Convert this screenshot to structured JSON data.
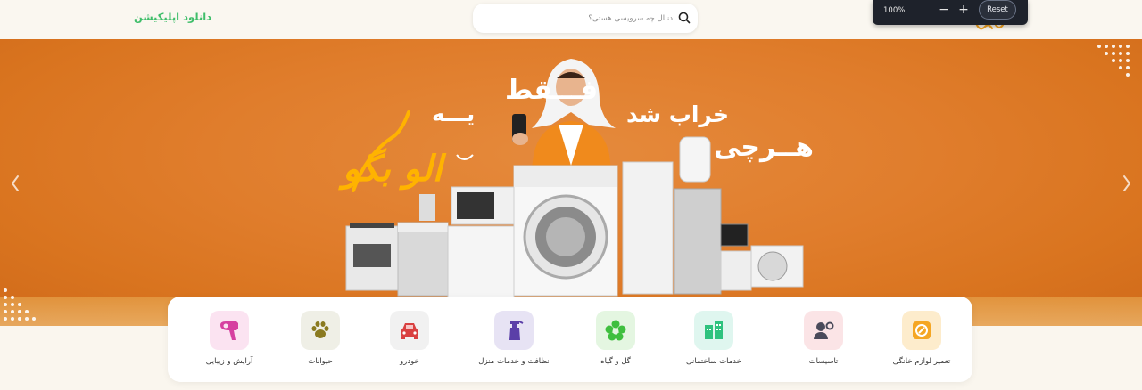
{
  "header": {
    "download_app": "دانلود اپلیکیشن",
    "search_placeholder": "دنبال چه سرویسی هستی؟"
  },
  "zoom": {
    "value": "100%",
    "minus": "−",
    "plus": "+",
    "reset": "Reset"
  },
  "banner": {
    "line1": "فـــقط",
    "line2a": "یـــه",
    "line2b": "خراب شد",
    "line3": "هــرچی",
    "brand_script": "الو بگو",
    "brand_tag": "لو"
  },
  "services": [
    {
      "label": "تعمیر لوازم خانگی",
      "icon": "appliance-icon",
      "color": "#f5a623"
    },
    {
      "label": "تاسیسات",
      "icon": "technician-icon",
      "color": "#4a4a5a"
    },
    {
      "label": "خدمات ساختمانی",
      "icon": "building-icon",
      "color": "#2ec27e"
    },
    {
      "label": "گل و گیاه",
      "icon": "flower-icon",
      "color": "#3fbf3f"
    },
    {
      "label": "نظافت و خدمات منزل",
      "icon": "spray-bottle-icon",
      "color": "#5b3fa8"
    },
    {
      "label": "خودرو",
      "icon": "car-icon",
      "color": "#d94040"
    },
    {
      "label": "حیوانات",
      "icon": "paw-icon",
      "color": "#8a7a20"
    },
    {
      "label": "آرایش و زیبایی",
      "icon": "hair-dryer-icon",
      "color": "#d63fa0"
    }
  ],
  "colors": {
    "accent_green": "#3fbe6a",
    "banner_orange": "#e07d2c",
    "brand_yellow": "#ffb300"
  }
}
